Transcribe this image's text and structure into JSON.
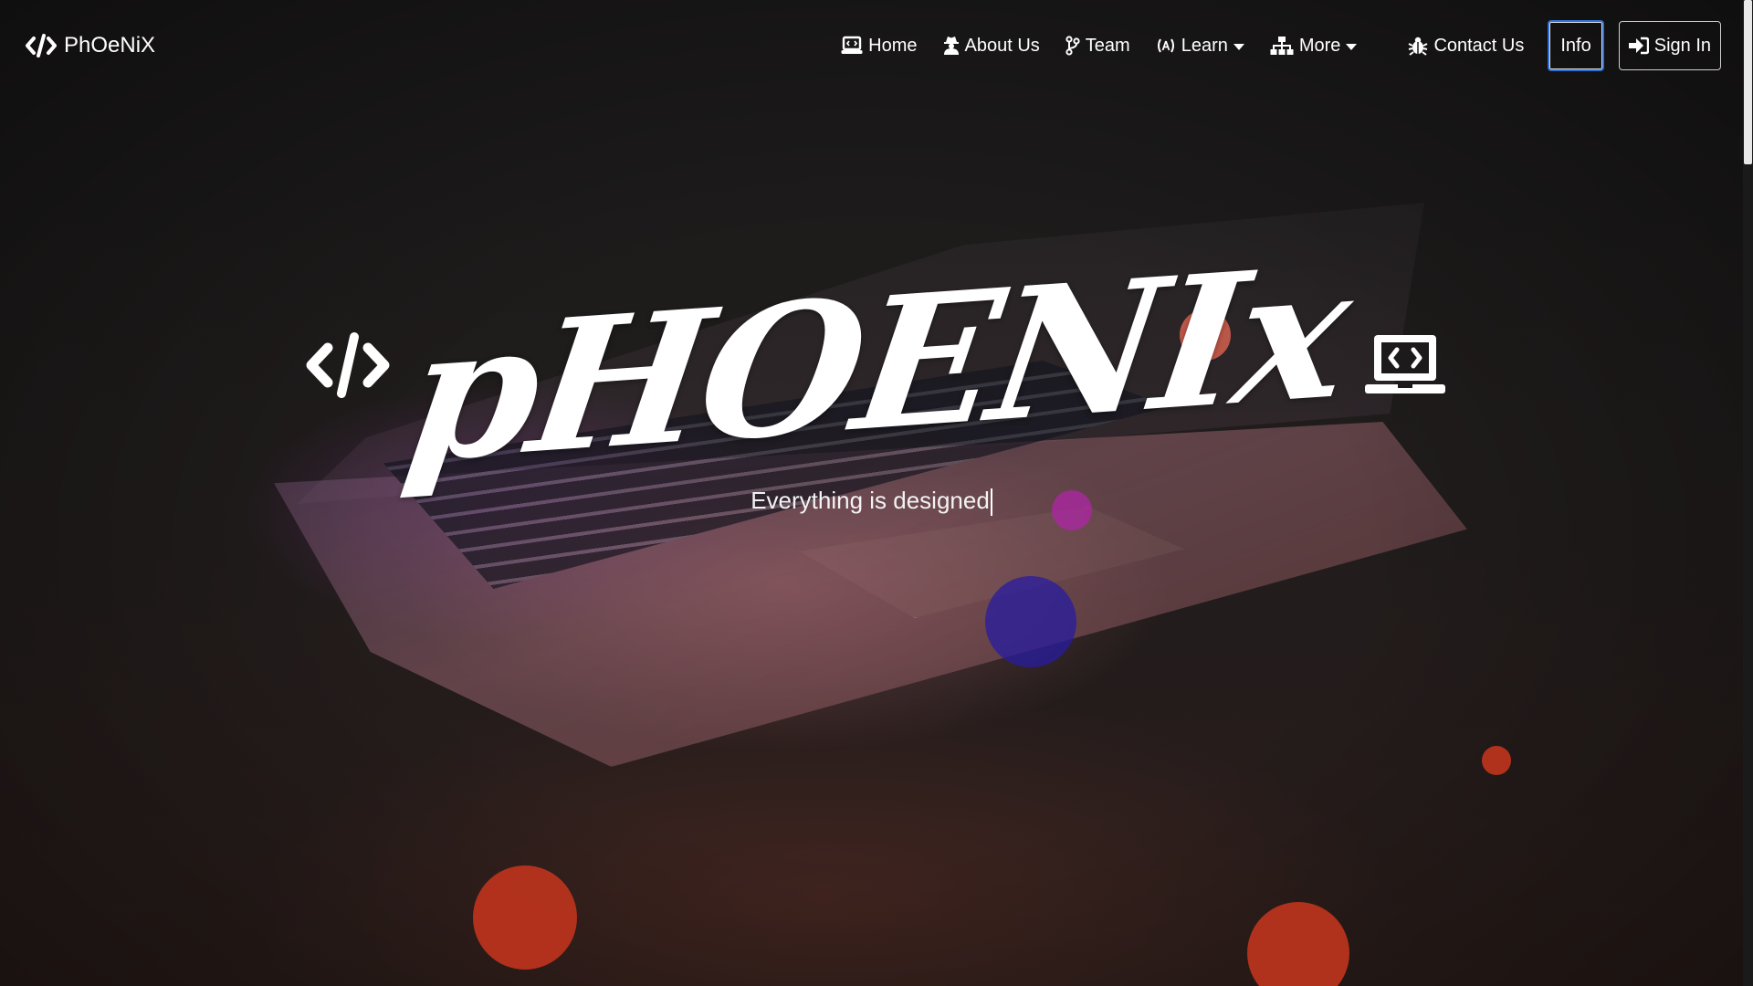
{
  "navbar": {
    "brand": "PhOeNiX",
    "items": [
      {
        "label": "Home",
        "icon": "laptop-code-icon"
      },
      {
        "label": "About Us",
        "icon": "user-secret-icon"
      },
      {
        "label": "Team",
        "icon": "code-branch-icon"
      },
      {
        "label": "Learn",
        "icon": "broadcast-icon",
        "dropdown": true
      },
      {
        "label": "More",
        "icon": "sitemap-icon",
        "dropdown": true
      },
      {
        "label": "Contact Us",
        "icon": "bug-icon"
      }
    ],
    "info_label": "Info",
    "signin_label": "Sign In"
  },
  "hero": {
    "title": "pHOENIx",
    "subtitle": "Everything is designed"
  },
  "colors": {
    "background": "#1c1a1a",
    "text": "#ffffff",
    "info_border": "#2f6fd6",
    "bubble_red": "#c0341d",
    "bubble_purple": "#a7329a",
    "bubble_blue": "#2b1fa0",
    "bubble_salmon": "#e0604a"
  }
}
